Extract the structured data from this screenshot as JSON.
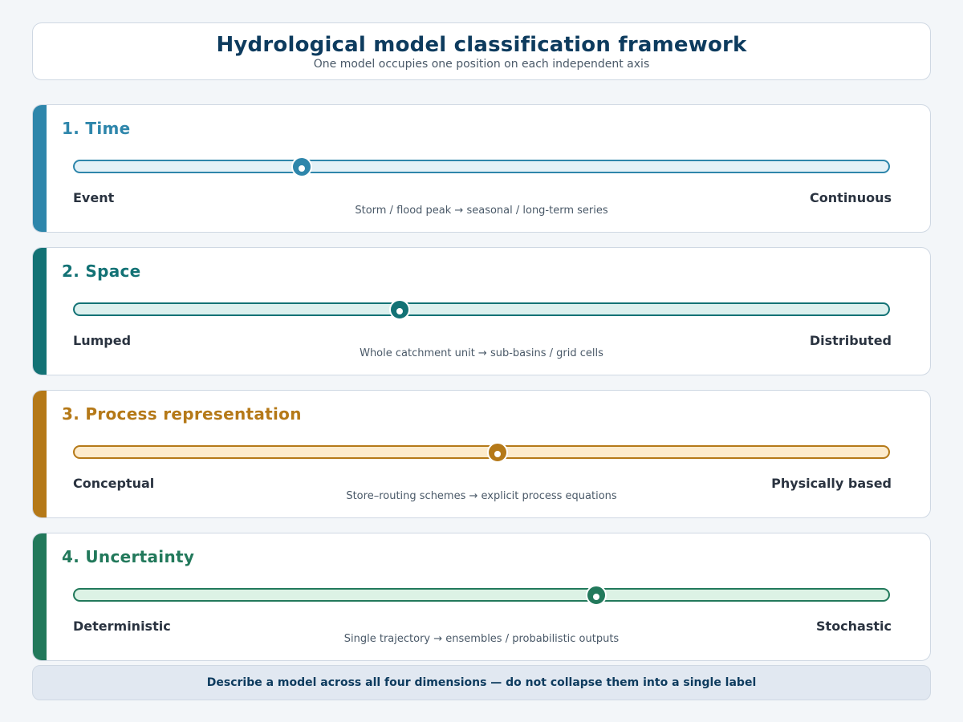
{
  "header": {
    "title": "Hydrological model classification framework",
    "subtitle": "One model occupies one position on each independent axis"
  },
  "axes": [
    {
      "title": "1. Time",
      "left_label": "Event",
      "right_label": "Continuous",
      "description": "Storm / flood peak  →  seasonal / long-term series",
      "position": 0.28,
      "color": "#2e86ab",
      "track_fill": "#e3f1f7"
    },
    {
      "title": "2. Space",
      "left_label": "Lumped",
      "right_label": "Distributed",
      "description": "Whole catchment unit  →  sub-basins / grid cells",
      "position": 0.4,
      "color": "#137275",
      "track_fill": "#dcf0ee"
    },
    {
      "title": "3. Process representation",
      "left_label": "Conceptual",
      "right_label": "Physically based",
      "description": "Store–routing schemes  →  explicit process equations",
      "position": 0.52,
      "color": "#b57918",
      "track_fill": "#fdebcc"
    },
    {
      "title": "4. Uncertainty",
      "left_label": "Deterministic",
      "right_label": "Stochastic",
      "description": "Single trajectory  →  ensembles / probabilistic outputs",
      "position": 0.64,
      "color": "#22795b",
      "track_fill": "#dcf2e5"
    }
  ],
  "footer": {
    "note": "Describe a model across all four dimensions — do not collapse them into a single label"
  }
}
